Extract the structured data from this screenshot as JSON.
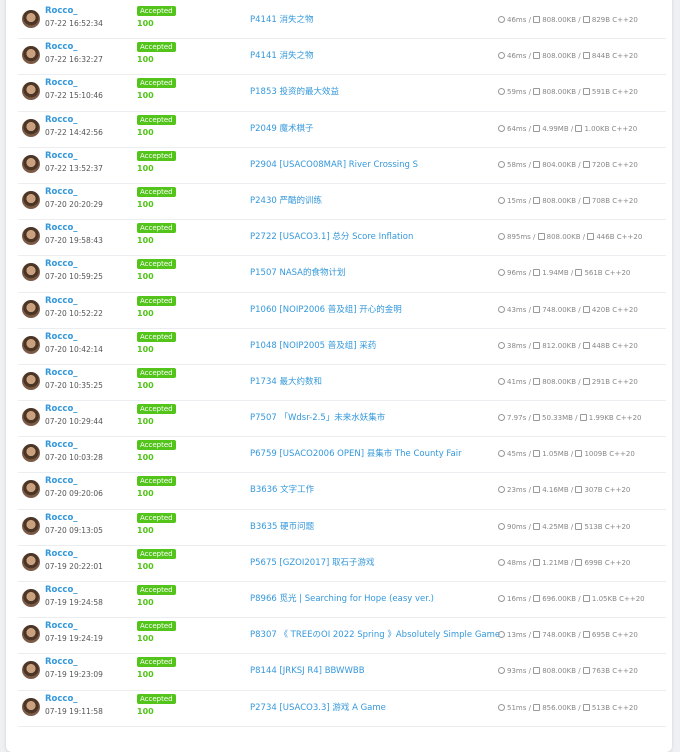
{
  "submissions": [
    {
      "user": "Rocco_",
      "time": "07-22 16:52:34",
      "status": "Accepted",
      "score": "100",
      "problem": "P4141 消失之物",
      "runtime": "46ms",
      "memory": "808.00KB",
      "code_size": "829B",
      "lang": "C++20"
    },
    {
      "user": "Rocco_",
      "time": "07-22 16:32:27",
      "status": "Accepted",
      "score": "100",
      "problem": "P4141 消失之物",
      "runtime": "46ms",
      "memory": "808.00KB",
      "code_size": "844B",
      "lang": "C++20"
    },
    {
      "user": "Rocco_",
      "time": "07-22 15:10:46",
      "status": "Accepted",
      "score": "100",
      "problem": "P1853 投资的最大效益",
      "runtime": "59ms",
      "memory": "808.00KB",
      "code_size": "591B",
      "lang": "C++20"
    },
    {
      "user": "Rocco_",
      "time": "07-22 14:42:56",
      "status": "Accepted",
      "score": "100",
      "problem": "P2049 魔术棋子",
      "runtime": "64ms",
      "memory": "4.99MB",
      "code_size": "1.00KB",
      "lang": "C++20"
    },
    {
      "user": "Rocco_",
      "time": "07-22 13:52:37",
      "status": "Accepted",
      "score": "100",
      "problem": "P2904 [USACO08MAR] River Crossing S",
      "runtime": "58ms",
      "memory": "804.00KB",
      "code_size": "720B",
      "lang": "C++20"
    },
    {
      "user": "Rocco_",
      "time": "07-20 20:20:29",
      "status": "Accepted",
      "score": "100",
      "problem": "P2430 严酷的训练",
      "runtime": "15ms",
      "memory": "808.00KB",
      "code_size": "708B",
      "lang": "C++20"
    },
    {
      "user": "Rocco_",
      "time": "07-20 19:58:43",
      "status": "Accepted",
      "score": "100",
      "problem": "P2722 [USACO3.1] 总分 Score Inflation",
      "runtime": "895ms",
      "memory": "808.00KB",
      "code_size": "446B",
      "lang": "C++20"
    },
    {
      "user": "Rocco_",
      "time": "07-20 10:59:25",
      "status": "Accepted",
      "score": "100",
      "problem": "P1507 NASA的食物计划",
      "runtime": "96ms",
      "memory": "1.94MB",
      "code_size": "561B",
      "lang": "C++20"
    },
    {
      "user": "Rocco_",
      "time": "07-20 10:52:22",
      "status": "Accepted",
      "score": "100",
      "problem": "P1060 [NOIP2006 普及组] 开心的金明",
      "runtime": "43ms",
      "memory": "748.00KB",
      "code_size": "420B",
      "lang": "C++20"
    },
    {
      "user": "Rocco_",
      "time": "07-20 10:42:14",
      "status": "Accepted",
      "score": "100",
      "problem": "P1048 [NOIP2005 普及组] 采药",
      "runtime": "38ms",
      "memory": "812.00KB",
      "code_size": "448B",
      "lang": "C++20"
    },
    {
      "user": "Rocco_",
      "time": "07-20 10:35:25",
      "status": "Accepted",
      "score": "100",
      "problem": "P1734 最大约数和",
      "runtime": "41ms",
      "memory": "808.00KB",
      "code_size": "291B",
      "lang": "C++20"
    },
    {
      "user": "Rocco_",
      "time": "07-20 10:29:44",
      "status": "Accepted",
      "score": "100",
      "problem": "P7507 「Wdsr-2.5」未来水妖集市",
      "runtime": "7.97s",
      "memory": "50.33MB",
      "code_size": "1.99KB",
      "lang": "C++20"
    },
    {
      "user": "Rocco_",
      "time": "07-20 10:03:28",
      "status": "Accepted",
      "score": "100",
      "problem": "P6759 [USACO2006 OPEN] 县集市 The County Fair",
      "runtime": "45ms",
      "memory": "1.05MB",
      "code_size": "1009B",
      "lang": "C++20"
    },
    {
      "user": "Rocco_",
      "time": "07-20 09:20:06",
      "status": "Accepted",
      "score": "100",
      "problem": "B3636 文字工作",
      "runtime": "23ms",
      "memory": "4.16MB",
      "code_size": "307B",
      "lang": "C++20"
    },
    {
      "user": "Rocco_",
      "time": "07-20 09:13:05",
      "status": "Accepted",
      "score": "100",
      "problem": "B3635 硬币问题",
      "runtime": "90ms",
      "memory": "4.25MB",
      "code_size": "513B",
      "lang": "C++20"
    },
    {
      "user": "Rocco_",
      "time": "07-19 20:22:01",
      "status": "Accepted",
      "score": "100",
      "problem": "P5675 [GZOI2017] 取石子游戏",
      "runtime": "48ms",
      "memory": "1.21MB",
      "code_size": "699B",
      "lang": "C++20"
    },
    {
      "user": "Rocco_",
      "time": "07-19 19:24:58",
      "status": "Accepted",
      "score": "100",
      "problem": "P8966 觅光 | Searching for Hope (easy ver.)",
      "runtime": "16ms",
      "memory": "696.00KB",
      "code_size": "1.05KB",
      "lang": "C++20"
    },
    {
      "user": "Rocco_",
      "time": "07-19 19:24:19",
      "status": "Accepted",
      "score": "100",
      "problem": "P8307 《 TREEのOI 2022 Spring 》Absolutely Simple Game",
      "runtime": "13ms",
      "memory": "748.00KB",
      "code_size": "695B",
      "lang": "C++20"
    },
    {
      "user": "Rocco_",
      "time": "07-19 19:23:09",
      "status": "Accepted",
      "score": "100",
      "problem": "P8144 [JRKSJ R4] BBWWBB",
      "runtime": "93ms",
      "memory": "808.00KB",
      "code_size": "763B",
      "lang": "C++20"
    },
    {
      "user": "Rocco_",
      "time": "07-19 19:11:58",
      "status": "Accepted",
      "score": "100",
      "problem": "P2734 [USACO3.3] 游戏 A Game",
      "runtime": "51ms",
      "memory": "856.00KB",
      "code_size": "513B",
      "lang": "C++20"
    }
  ],
  "separator": " / ",
  "colors": {
    "link": "#3498db",
    "accepted": "#52c41a",
    "muted": "#888888"
  }
}
